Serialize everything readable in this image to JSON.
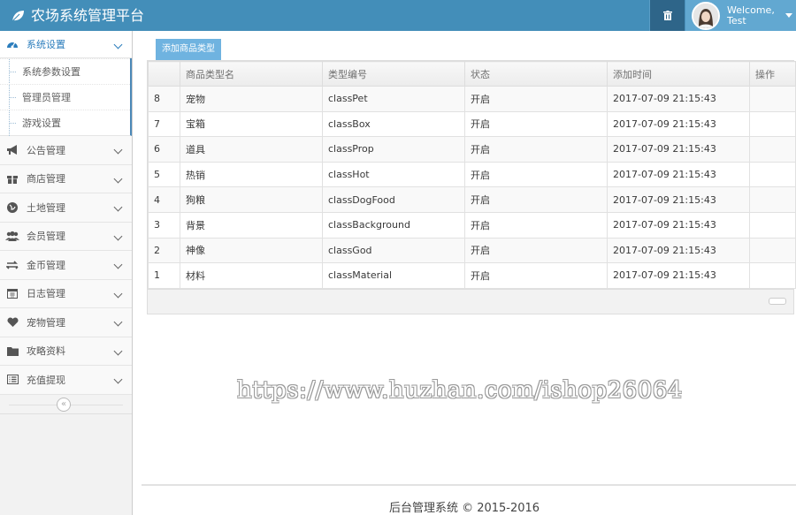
{
  "app": {
    "title": "农场系统管理平台"
  },
  "header": {
    "user_greeting": "Welcome,",
    "user_name": "Test",
    "colors": {
      "bar": "#438eb9",
      "trash_bg": "#2e6589",
      "user_bg": "#62a8d1"
    }
  },
  "sidebar": {
    "active_menu": {
      "label": "系统设置",
      "icon": "dashboard-icon"
    },
    "submenu": [
      {
        "label": "系统参数设置"
      },
      {
        "label": "管理员管理"
      },
      {
        "label": "游戏设置"
      }
    ],
    "items": [
      {
        "label": "公告管理",
        "icon": "bullhorn-icon"
      },
      {
        "label": "商店管理",
        "icon": "gift-icon"
      },
      {
        "label": "土地管理",
        "icon": "globe-icon"
      },
      {
        "label": "会员管理",
        "icon": "users-icon"
      },
      {
        "label": "金币管理",
        "icon": "exchange-icon"
      },
      {
        "label": "日志管理",
        "icon": "calendar-icon"
      },
      {
        "label": "宠物管理",
        "icon": "heart-icon"
      },
      {
        "label": "攻略资料",
        "icon": "folder-icon"
      },
      {
        "label": "充值提现",
        "icon": "list-alt-icon"
      }
    ],
    "collapse_symbol": "«"
  },
  "toolbar": {
    "add_label": "添加商品类型"
  },
  "table": {
    "headers": [
      "",
      "商品类型名",
      "类型编号",
      "状态",
      "添加时间",
      "操作"
    ],
    "rows": [
      [
        "8",
        "宠物",
        "classPet",
        "开启",
        "2017-07-09 21:15:43",
        ""
      ],
      [
        "7",
        "宝箱",
        "classBox",
        "开启",
        "2017-07-09 21:15:43",
        ""
      ],
      [
        "6",
        "道具",
        "classProp",
        "开启",
        "2017-07-09 21:15:43",
        ""
      ],
      [
        "5",
        "热销",
        "classHot",
        "开启",
        "2017-07-09 21:15:43",
        ""
      ],
      [
        "4",
        "狗粮",
        "classDogFood",
        "开启",
        "2017-07-09 21:15:43",
        ""
      ],
      [
        "3",
        "背景",
        "classBackground",
        "开启",
        "2017-07-09 21:15:43",
        ""
      ],
      [
        "2",
        "神像",
        "classGod",
        "开启",
        "2017-07-09 21:15:43",
        ""
      ],
      [
        "1",
        "材料",
        "classMaterial",
        "开启",
        "2017-07-09 21:15:43",
        ""
      ]
    ]
  },
  "watermark": "https://www.huzhan.com/ishop26064",
  "footer": {
    "text": "后台管理系统 © 2015-2016"
  }
}
